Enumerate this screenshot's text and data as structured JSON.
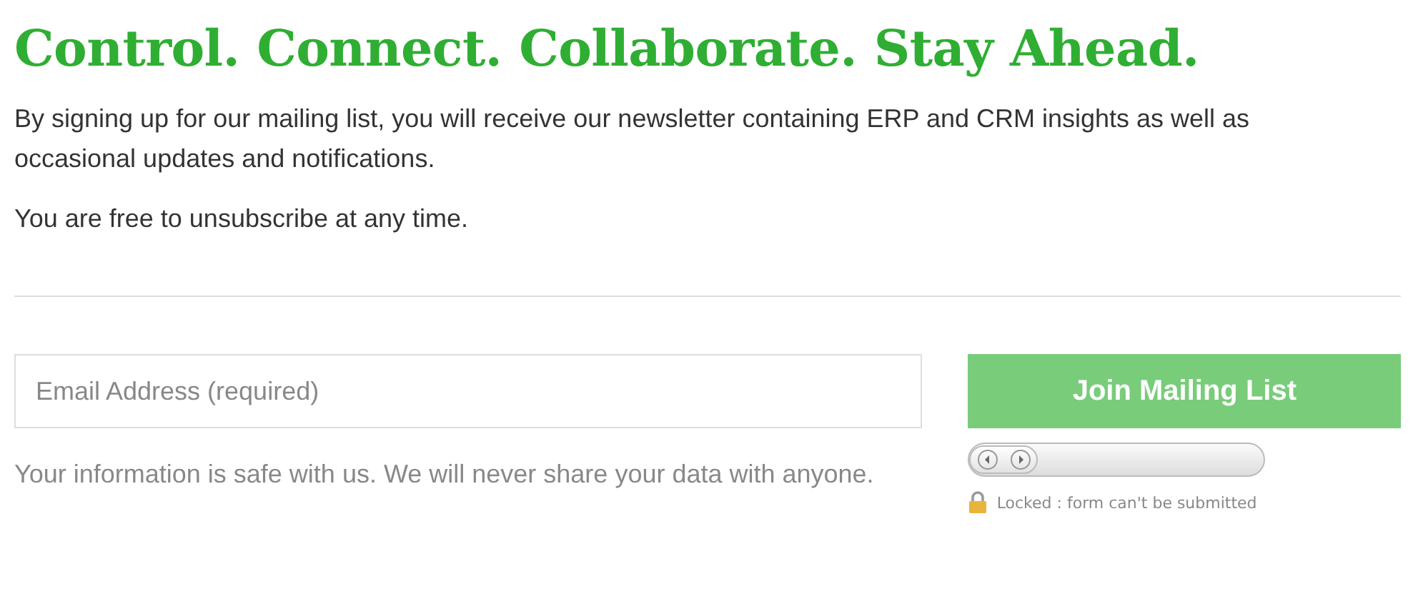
{
  "heading": "Control. Connect. Collaborate. Stay Ahead.",
  "paragraphs": [
    "By signing up for our mailing list, you will receive our newsletter containing ERP and CRM insights as well as occasional updates and notifications.",
    "You are free to unsubscribe at any time."
  ],
  "form": {
    "email": {
      "placeholder": "Email Address (required)"
    },
    "privacy_note": "Your information is safe with us. We will never share your data with anyone.",
    "submit_button": "Join Mailing List",
    "lock_status": {
      "locked": true,
      "text": "Locked : form can't be submitted"
    }
  }
}
